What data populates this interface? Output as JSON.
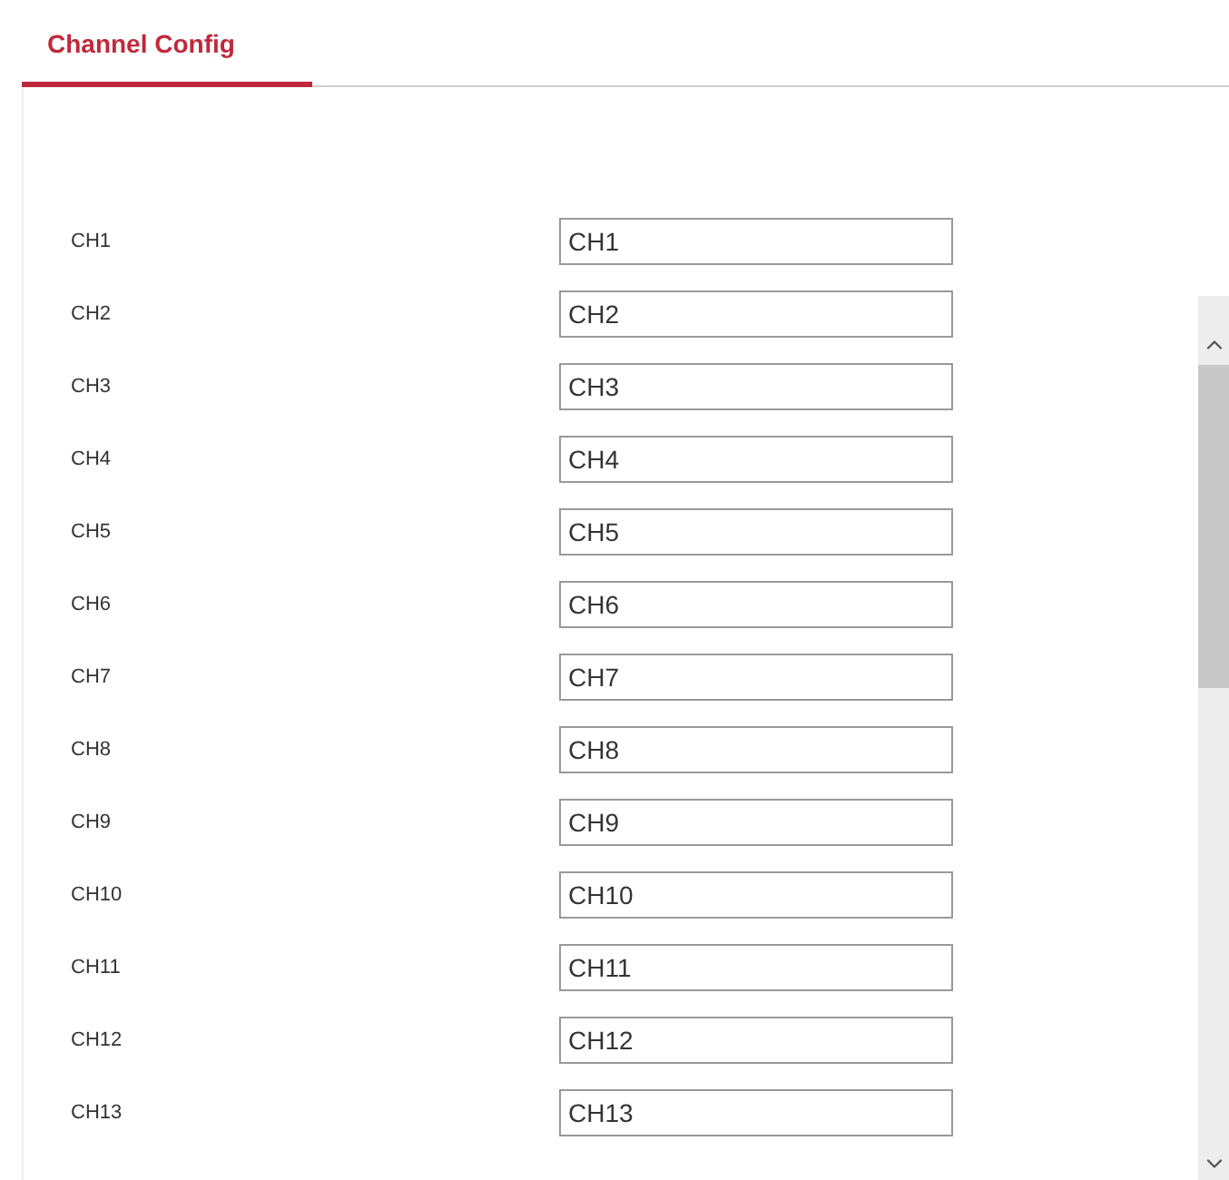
{
  "tabs": [
    {
      "label": "Channel Config",
      "selected": true
    }
  ],
  "channels": [
    {
      "label": "CH1",
      "value": "CH1"
    },
    {
      "label": "CH2",
      "value": "CH2"
    },
    {
      "label": "CH3",
      "value": "CH3"
    },
    {
      "label": "CH4",
      "value": "CH4"
    },
    {
      "label": "CH5",
      "value": "CH5"
    },
    {
      "label": "CH6",
      "value": "CH6"
    },
    {
      "label": "CH7",
      "value": "CH7"
    },
    {
      "label": "CH8",
      "value": "CH8"
    },
    {
      "label": "CH9",
      "value": "CH9"
    },
    {
      "label": "CH10",
      "value": "CH10"
    },
    {
      "label": "CH11",
      "value": "CH11"
    },
    {
      "label": "CH12",
      "value": "CH12"
    },
    {
      "label": "CH13",
      "value": "CH13"
    }
  ]
}
